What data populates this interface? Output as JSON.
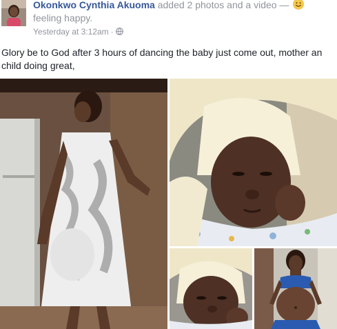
{
  "post": {
    "author": "Okonkwo Cynthia Akuoma",
    "action": " added 2 photos and a video — ",
    "feeling": "feeling happy.",
    "timestamp": "Yesterday at 3:12am",
    "separator": "·",
    "privacy_icon": "globe-icon",
    "feeling_icon": "smiley-icon",
    "text": "Glory be to God after 3 hours of dancing the baby just come out, mother an child doing great,"
  },
  "colors": {
    "author_link": "#365899",
    "secondary_text": "#90949c",
    "body_text": "#1d2129",
    "feeling_emoji": "#f7c948"
  },
  "media": {
    "items": [
      {
        "type": "video",
        "name": "dancing-woman-video"
      },
      {
        "type": "photo",
        "name": "newborn-baby-photo"
      },
      {
        "type": "photo",
        "name": "newborn-baby-closeup-photo"
      },
      {
        "type": "photo",
        "name": "pregnant-woman-photo"
      }
    ]
  }
}
